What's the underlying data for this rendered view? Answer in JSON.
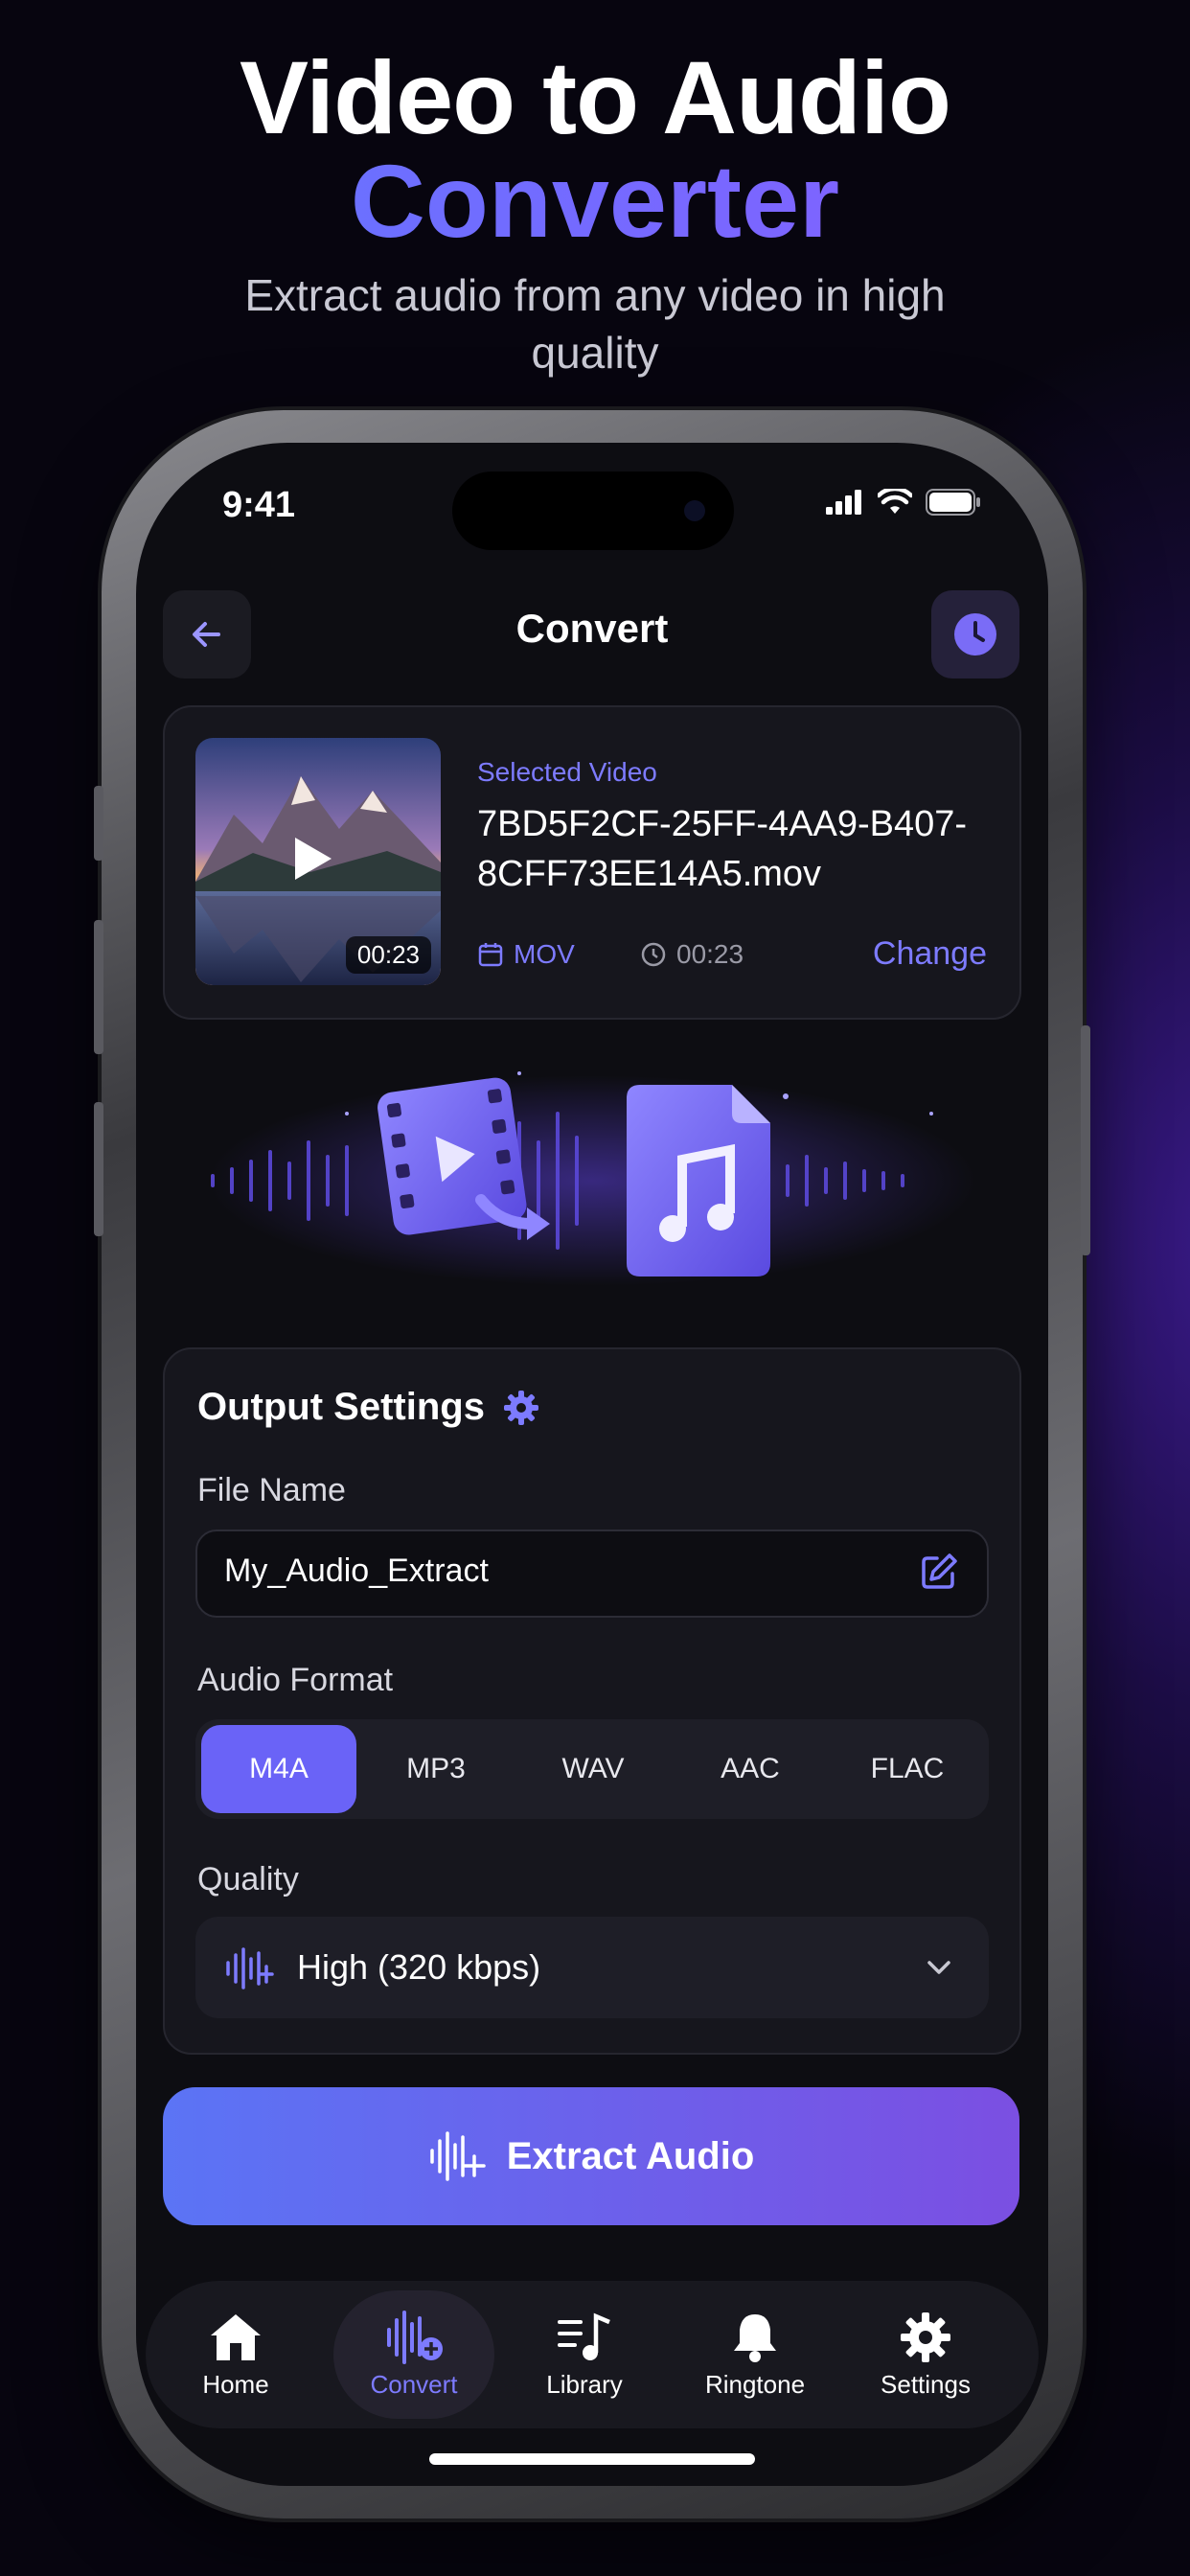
{
  "hero": {
    "title_line1": "Video to Audio",
    "title_line2": "Converter",
    "subtitle": "Extract audio from any video in high quality"
  },
  "status": {
    "time": "9:41"
  },
  "nav": {
    "title": "Convert"
  },
  "video": {
    "section_label": "Selected Video",
    "file_name": "7BD5F2CF-25FF-4AA9-B407-8CFF73EE14A5.mov",
    "thumb_duration": "00:23",
    "format": "MOV",
    "duration": "00:23",
    "change_label": "Change"
  },
  "settings": {
    "title": "Output Settings",
    "file_name_label": "File Name",
    "file_name_value": "My_Audio_Extract",
    "audio_format_label": "Audio Format",
    "formats": [
      "M4A",
      "MP3",
      "WAV",
      "AAC",
      "FLAC"
    ],
    "selected_format": "M4A",
    "quality_label": "Quality",
    "quality_value": "High (320 kbps)"
  },
  "cta": {
    "label": "Extract Audio"
  },
  "tabs": [
    {
      "label": "Home",
      "icon": "home-icon"
    },
    {
      "label": "Convert",
      "icon": "waveform-plus-icon",
      "active": true
    },
    {
      "label": "Library",
      "icon": "music-library-icon"
    },
    {
      "label": "Ringtone",
      "icon": "bell-icon"
    },
    {
      "label": "Settings",
      "icon": "gear-icon"
    }
  ],
  "colors": {
    "accent": "#6a63f7",
    "accent_text": "#7d7bff",
    "card": "#16161d",
    "background": "#0d0d12"
  }
}
